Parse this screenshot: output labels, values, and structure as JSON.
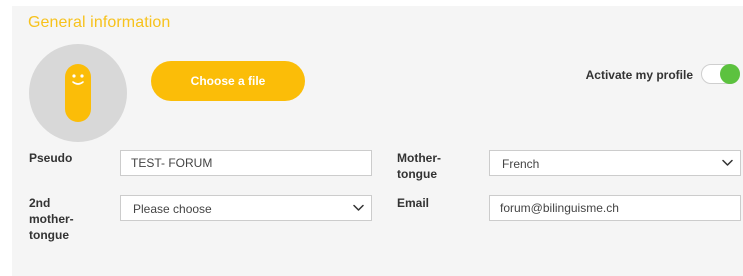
{
  "section": {
    "title": "General information"
  },
  "avatar": {
    "icon": "smiley-figure-icon",
    "color": "#fbbd08"
  },
  "upload": {
    "label": "Choose a file"
  },
  "profile": {
    "activate_label": "Activate my profile",
    "active": true,
    "toggle_color": "#5cc23f"
  },
  "form": {
    "pseudo": {
      "label": "Pseudo",
      "value": "TEST- FORUM"
    },
    "mother_tongue": {
      "label": "Mother-tongue",
      "value": "French",
      "icon": "chevron-down-icon"
    },
    "second_mother_tongue": {
      "label": "2nd mother-tongue",
      "value": "Please choose",
      "icon": "chevron-down-icon"
    },
    "email": {
      "label": "Email",
      "value": "forum@bilinguisme.ch"
    }
  },
  "colors": {
    "accent": "#f7c21c",
    "panel_bg": "#f5f5f5"
  }
}
